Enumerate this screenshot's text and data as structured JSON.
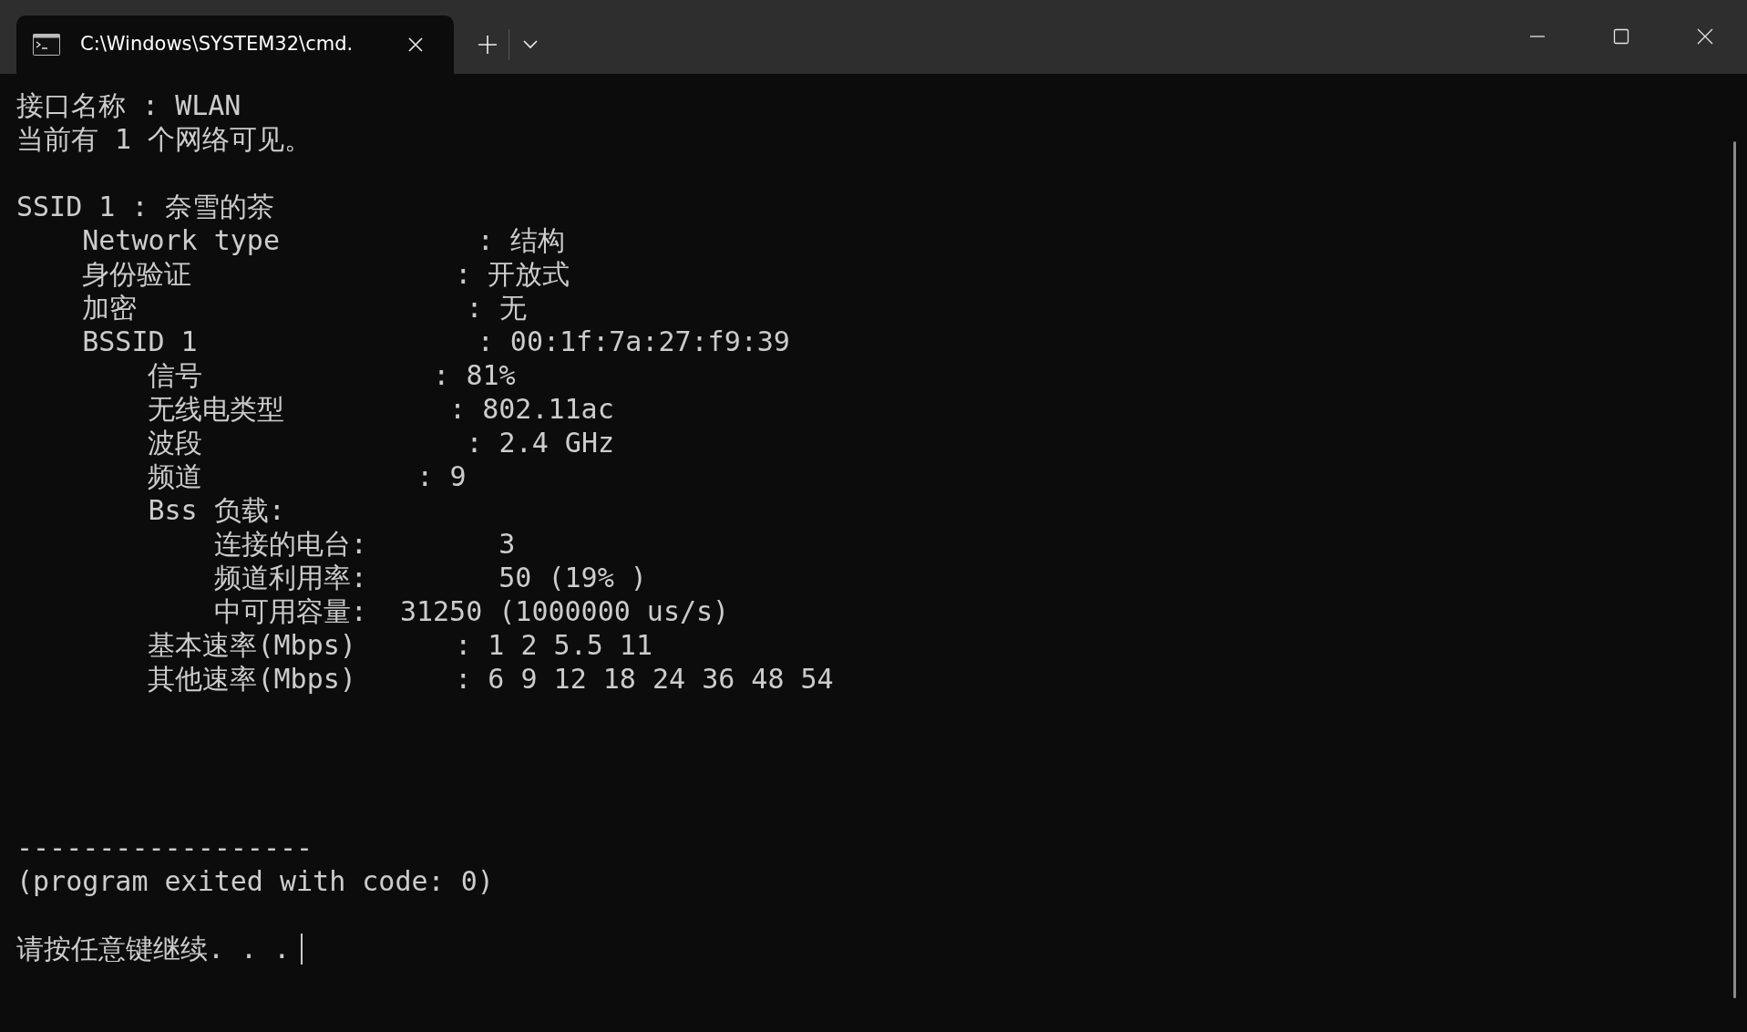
{
  "window": {
    "controls": [
      {
        "kind": "minimize"
      },
      {
        "kind": "maximize"
      },
      {
        "kind": "close"
      }
    ]
  },
  "tabs": [
    {
      "title": "C:\\Windows\\SYSTEM32\\cmd.",
      "selected": true
    }
  ],
  "terminal": {
    "blocks": [
      {
        "kind": "output",
        "lines": [
          "接口名称 : WLAN",
          "当前有 1 个网络可见。"
        ]
      },
      {
        "kind": "output",
        "lines": [
          "SSID 1 : 奈雪的茶",
          "    Network type            : 结构",
          "    身份验证                : 开放式",
          "    加密                    : 无",
          "    BSSID 1                 : 00:1f:7a:27:f9:39",
          "        信号              : 81%",
          "        无线电类型          : 802.11ac",
          "        波段                : 2.4 GHz",
          "        频道             : 9",
          "        Bss 负载:",
          "            连接的电台:        3",
          "            频道利用率:        50 (19% )",
          "            中可用容量:  31250 (1000000 us/s)",
          "        基本速率(Mbps)      : 1 2 5.5 11",
          "        其他速率(Mbps)      : 6 9 12 18 24 36 48 54"
        ]
      },
      {
        "kind": "trailer",
        "lines": [
          "------------------",
          "(program exited with code: 0)"
        ]
      },
      {
        "kind": "output",
        "lines": [
          "请按任意键继续. . ."
        ]
      }
    ],
    "cursor": true
  }
}
